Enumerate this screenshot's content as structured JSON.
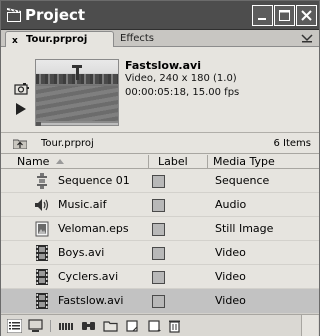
{
  "window": {
    "title": "Project",
    "icons": {
      "app": "clapper-icon",
      "minimize": "minimize-icon",
      "maximize": "maximize-icon",
      "close": "close-icon"
    }
  },
  "tabs": [
    {
      "label": "Tour.prproj",
      "active": true,
      "close": "x"
    },
    {
      "label": "Effects",
      "active": false
    }
  ],
  "preview": {
    "clip_name": "Fastslow.avi",
    "info_line1": "Video, 240 x 180 (1.0)",
    "info_line2": "00:00:05:18, 15.00 fps"
  },
  "bin": {
    "name": "Tour.prproj",
    "item_count": "6 Items"
  },
  "columns": {
    "name": "Name",
    "label": "Label",
    "media_type": "Media Type"
  },
  "items": [
    {
      "name": "Sequence 01",
      "media_type": "Sequence",
      "icon": "sequence-icon",
      "label_color": "#b8b8b8",
      "selected": false
    },
    {
      "name": "Music.aif",
      "media_type": "Audio",
      "icon": "speaker-icon",
      "label_color": "#b8b8b8",
      "selected": false
    },
    {
      "name": "Veloman.eps",
      "media_type": "Still Image",
      "icon": "still-image-icon",
      "label_color": "#b8b8b8",
      "selected": false
    },
    {
      "name": "Boys.avi",
      "media_type": "Video",
      "icon": "film-icon",
      "label_color": "#b8b8b8",
      "selected": false
    },
    {
      "name": "Cyclers.avi",
      "media_type": "Video",
      "icon": "film-icon",
      "label_color": "#b8b8b8",
      "selected": false
    },
    {
      "name": "Fastslow.avi",
      "media_type": "Video",
      "icon": "film-icon",
      "label_color": "#b8b8b8",
      "selected": true
    }
  ],
  "toolbar": {
    "buttons": [
      "list-view-icon",
      "icon-view-icon",
      "automate-to-sequence-icon",
      "find-icon",
      "new-bin-icon",
      "new-item-icon",
      "trash-icon"
    ]
  },
  "colors": {
    "titlebar": "#4d4d4d",
    "panel": "#e6e4df",
    "selected_row": "#c2c2c2"
  }
}
